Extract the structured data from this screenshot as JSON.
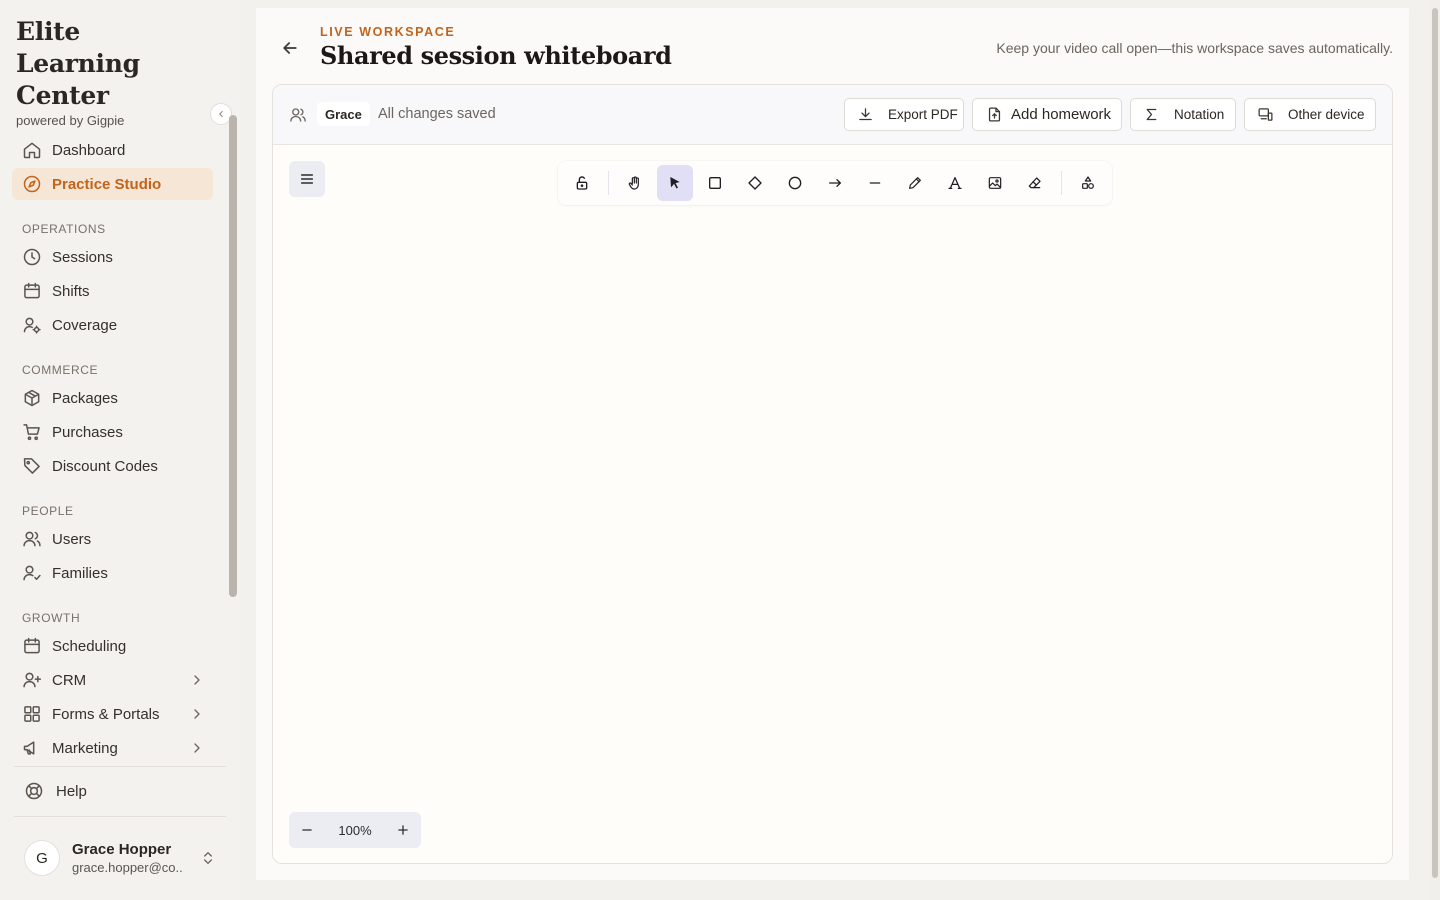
{
  "brand": {
    "name": "Elite Learning Center",
    "powered_by": "powered by Gigpie"
  },
  "nav": {
    "top": [
      {
        "label": "Dashboard",
        "icon": "home-icon"
      },
      {
        "label": "Practice Studio",
        "icon": "compass-icon",
        "active": true
      }
    ],
    "sections": [
      {
        "title": "OPERATIONS",
        "items": [
          {
            "label": "Sessions",
            "icon": "clock-icon"
          },
          {
            "label": "Shifts",
            "icon": "calendar-icon"
          },
          {
            "label": "Coverage",
            "icon": "user-cog-icon"
          }
        ]
      },
      {
        "title": "COMMERCE",
        "items": [
          {
            "label": "Packages",
            "icon": "package-icon"
          },
          {
            "label": "Purchases",
            "icon": "cart-icon"
          },
          {
            "label": "Discount Codes",
            "icon": "tag-icon"
          }
        ]
      },
      {
        "title": "PEOPLE",
        "items": [
          {
            "label": "Users",
            "icon": "users-icon"
          },
          {
            "label": "Families",
            "icon": "user-check-icon"
          }
        ]
      },
      {
        "title": "GROWTH",
        "items": [
          {
            "label": "Scheduling",
            "icon": "calendar-icon"
          },
          {
            "label": "CRM",
            "icon": "user-plus-icon",
            "expandable": true
          },
          {
            "label": "Forms & Portals",
            "icon": "grid-icon",
            "expandable": true
          },
          {
            "label": "Marketing",
            "icon": "megaphone-icon",
            "expandable": true
          }
        ]
      }
    ],
    "help": "Help"
  },
  "user": {
    "initial": "G",
    "name": "Grace Hopper",
    "email": "grace.hopper@co..."
  },
  "header": {
    "eyebrow": "LIVE WORKSPACE",
    "title": "Shared session whiteboard",
    "note": "Keep your video call open—this workspace saves automatically."
  },
  "board_toolbar": {
    "collaborator": "Grace",
    "status": "All changes saved",
    "buttons": {
      "export": "Export PDF",
      "homework": "Add homework",
      "notation": "Notation",
      "device": "Other device"
    }
  },
  "canvas": {
    "tools": [
      "lock",
      "hand",
      "selection",
      "rectangle",
      "diamond",
      "ellipse",
      "arrow",
      "line",
      "draw",
      "text",
      "image",
      "eraser",
      "more-tools"
    ],
    "selected_tool": "selection",
    "zoom": "100%"
  },
  "colors": {
    "accent": "#c4631a",
    "active_bg": "#f6e6d6",
    "tool_selected": "#e0dff5"
  }
}
